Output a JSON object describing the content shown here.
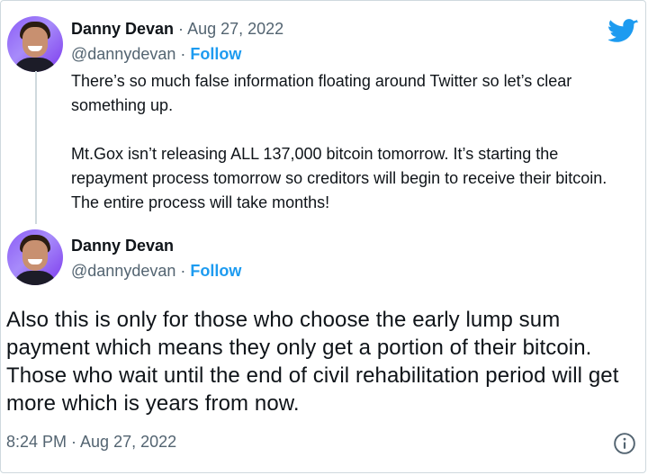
{
  "colors": {
    "accent": "#1d9bf0",
    "text": "#0f1419",
    "secondary": "#536471",
    "border": "#cfd9de"
  },
  "quoted_tweet": {
    "author_name": "Danny Devan",
    "separator": " · ",
    "date": "Aug 27, 2022",
    "handle": "@dannydevan",
    "follow_label": "Follow",
    "paragraphs": [
      "There’s so much false information floating around Twitter so let’s clear something up.",
      "Mt.Gox isn’t releasing ALL 137,000 bitcoin tomorrow. It’s starting the repayment process tomorrow so creditors will begin to receive their bitcoin. The entire process will take months!"
    ]
  },
  "main_tweet": {
    "author_name": "Danny Devan",
    "handle": "@dannydevan",
    "separator": " · ",
    "follow_label": "Follow",
    "text": "Also this is only for those who choose the early lump sum payment which means they only get a portion of their bitcoin. Those who wait until the end of civil rehabilitation period will get more which is years from now.",
    "timestamp": "8:24 PM · Aug 27, 2022"
  },
  "icons": {
    "brand": "twitter-bird-icon",
    "info": "info-icon"
  }
}
